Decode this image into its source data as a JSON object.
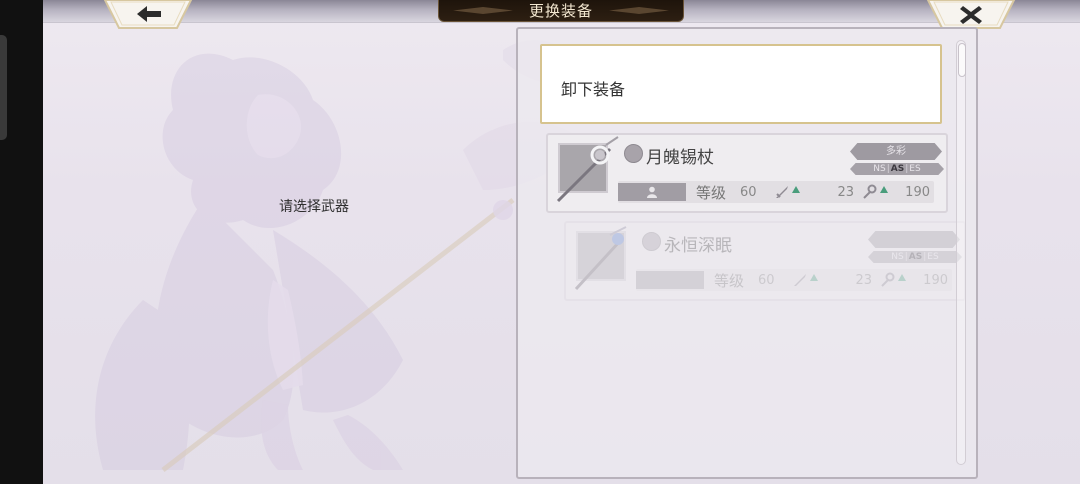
{
  "header": {
    "title": "更换装备",
    "back_icon": "arrow-left-icon",
    "close_icon": "close-x-icon"
  },
  "prompt": "请选择武器",
  "unequip_label": "卸下装备",
  "weapons": [
    {
      "name": "月魄锡杖",
      "tag": "多彩",
      "modes": [
        "NS",
        "AS",
        "ES"
      ],
      "level_label": "等级",
      "level": "60",
      "atk": "23",
      "matk": "190"
    },
    {
      "name": "永恒深眠",
      "tag": "",
      "modes": [
        "NS",
        "AS",
        "ES"
      ],
      "level_label": "等级",
      "level": "60",
      "atk": "23",
      "matk": "190"
    }
  ],
  "colors": {
    "title_bg": "#2d1f12",
    "accent_gold": "#d6c38e",
    "stat_up": "#4a9d7c"
  }
}
